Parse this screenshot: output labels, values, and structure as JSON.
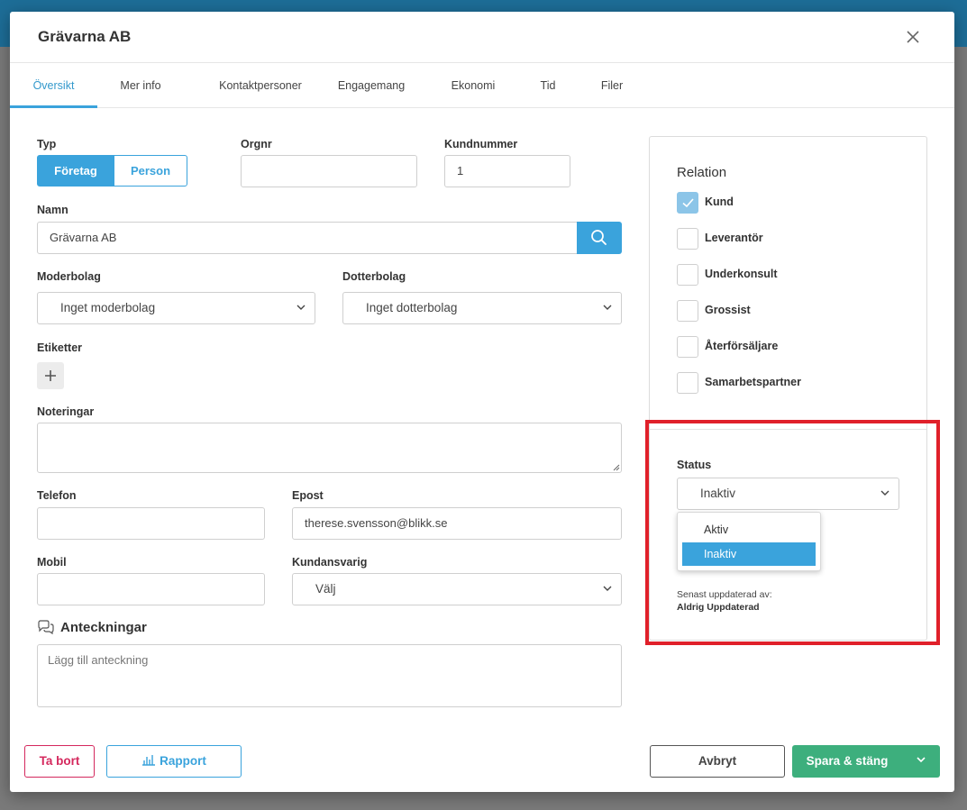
{
  "modal": {
    "title": "Grävarna AB"
  },
  "tabs": [
    {
      "label": "Översikt",
      "active": true
    },
    {
      "label": "Mer info"
    },
    {
      "label": "Kontaktpersoner"
    },
    {
      "label": "Engagemang"
    },
    {
      "label": "Ekonomi"
    },
    {
      "label": "Tid"
    },
    {
      "label": "Filer"
    }
  ],
  "form": {
    "typ": {
      "label": "Typ",
      "options": [
        "Företag",
        "Person"
      ],
      "selected": "Företag"
    },
    "orgnr": {
      "label": "Orgnr",
      "value": ""
    },
    "kundnummer": {
      "label": "Kundnummer",
      "value": "1"
    },
    "namn": {
      "label": "Namn",
      "value": "Grävarna AB"
    },
    "moderbolag": {
      "label": "Moderbolag",
      "value": "Inget moderbolag"
    },
    "dotterbolag": {
      "label": "Dotterbolag",
      "value": "Inget dotterbolag"
    },
    "etiketter": {
      "label": "Etiketter"
    },
    "noteringar": {
      "label": "Noteringar",
      "value": ""
    },
    "telefon": {
      "label": "Telefon",
      "value": ""
    },
    "epost": {
      "label": "Epost",
      "value": "therese.svensson@blikk.se"
    },
    "mobil": {
      "label": "Mobil",
      "value": ""
    },
    "kundansvarig": {
      "label": "Kundansvarig",
      "value": "Välj"
    }
  },
  "notes": {
    "title": "Anteckningar",
    "placeholder": "Lägg till anteckning"
  },
  "relation": {
    "title": "Relation",
    "items": [
      {
        "label": "Kund",
        "checked": true
      },
      {
        "label": "Leverantör",
        "checked": false
      },
      {
        "label": "Underkonsult",
        "checked": false
      },
      {
        "label": "Grossist",
        "checked": false
      },
      {
        "label": "Återförsäljare",
        "checked": false
      },
      {
        "label": "Samarbetspartner",
        "checked": false
      }
    ]
  },
  "status": {
    "label": "Status",
    "value": "Inaktiv",
    "options": [
      "Aktiv",
      "Inaktiv"
    ],
    "selected": "Inaktiv",
    "updated_label": "Senast uppdaterad av:",
    "updated_value": "Aldrig Uppdaterad"
  },
  "footer": {
    "delete": "Ta bort",
    "report": "Rapport",
    "cancel": "Avbryt",
    "save": "Spara & stäng"
  },
  "colors": {
    "accent": "#3aa3dc",
    "save": "#3daf7d",
    "danger": "#d4285d",
    "highlight": "#e0202a"
  }
}
